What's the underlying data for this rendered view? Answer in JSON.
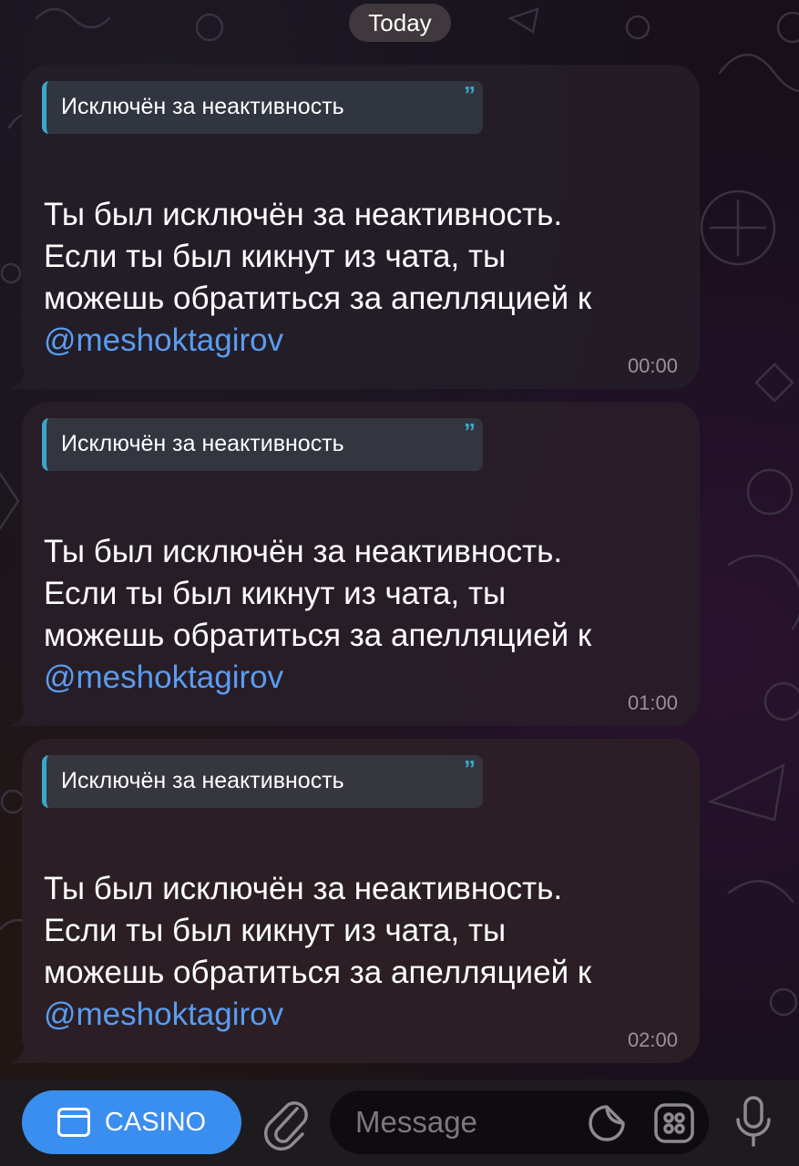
{
  "chat": {
    "date_label": "Today",
    "messages": [
      {
        "quote": "Исключён за неактивность",
        "lines": [
          "Ты был исключён за неактивность.",
          "Если ты был кикнут из чата, ты",
          "можешь обратиться за апелляцией к"
        ],
        "mention": "@meshoktagirov",
        "time": "00:00"
      },
      {
        "quote": "Исключён за неактивность",
        "lines": [
          "Ты был исключён за неактивность.",
          "Если ты был кикнут из чата, ты",
          "можешь обратиться за апелляцией к"
        ],
        "mention": "@meshoktagirov",
        "time": "01:00"
      },
      {
        "quote": "Исключён за неактивность",
        "lines": [
          "Ты был исключён за неактивность.",
          "Если ты был кикнут из чата, ты",
          "можешь обратиться за апелляцией к"
        ],
        "mention": "@meshoktagirov",
        "time": "02:00"
      }
    ]
  },
  "input_bar": {
    "casino_label": "CASINO",
    "message_placeholder": "Message",
    "icons": [
      "app-window-icon",
      "paperclip-icon",
      "sticker-icon",
      "emoji-grid-icon",
      "microphone-icon"
    ]
  },
  "colors": {
    "accent_blue": "#3a8ef0",
    "mention": "#5a9cf0",
    "quote_bar": "#3aa7c9"
  }
}
